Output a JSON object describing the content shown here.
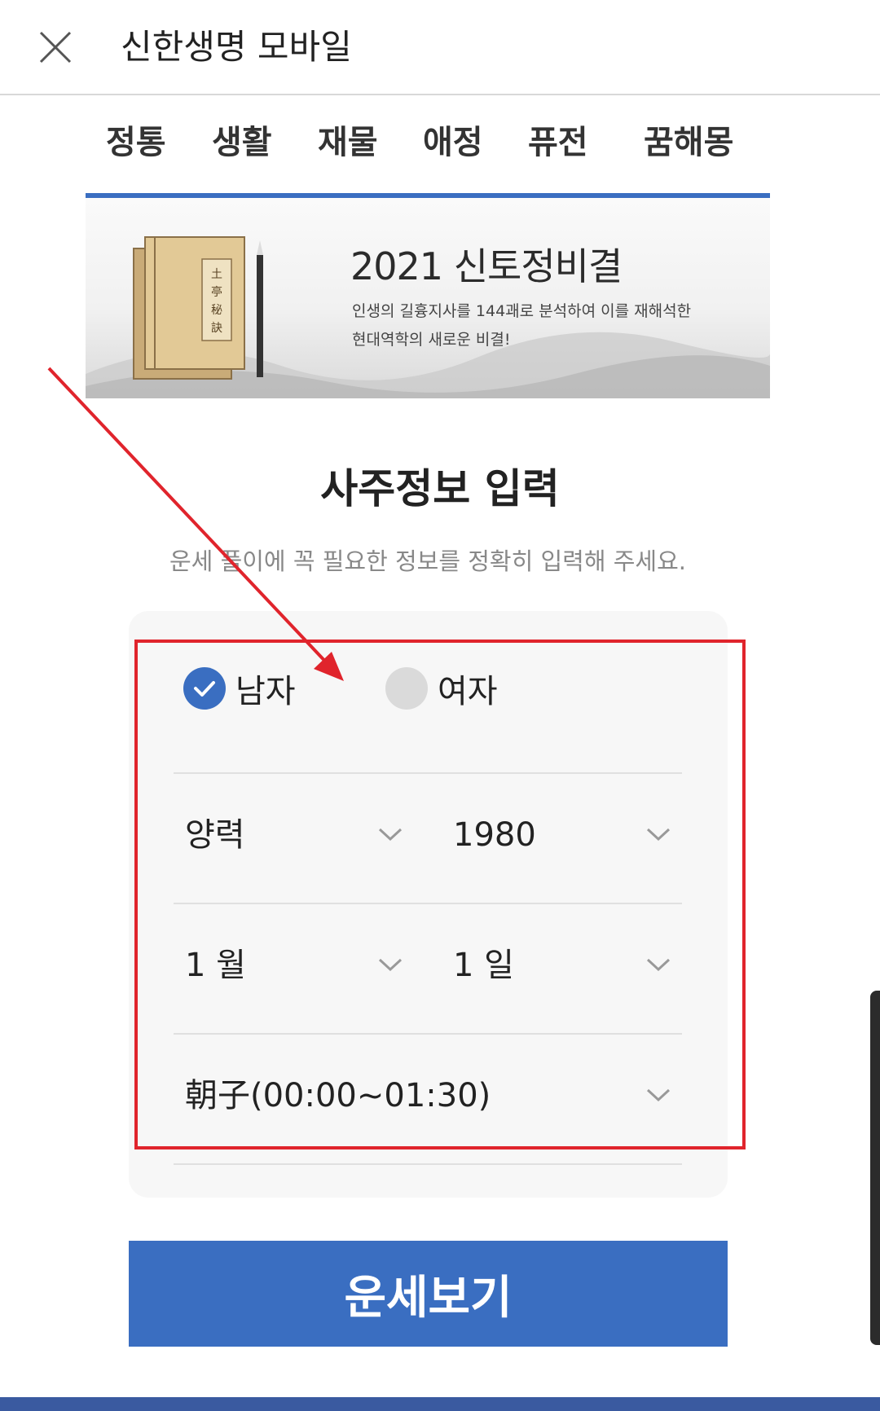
{
  "header": {
    "title": "신한생명 모바일",
    "close_icon": "close-icon"
  },
  "tabs": [
    {
      "label": "정통"
    },
    {
      "label": "생활"
    },
    {
      "label": "재물"
    },
    {
      "label": "애정"
    },
    {
      "label": "퓨전"
    },
    {
      "label": "꿈해몽"
    }
  ],
  "banner": {
    "title": "2021 신토정비결",
    "subtitle_line1": "인생의 길흉지사를 144괘로 분석하여 이를 재해석한",
    "subtitle_line2": "현대역학의 새로운 비결!",
    "book_label": "土亭秘訣"
  },
  "section": {
    "title": "사주정보 입력",
    "subtitle": "운세 풀이에 꼭 필요한 정보를 정확히 입력해 주세요."
  },
  "form": {
    "gender": {
      "male_label": "남자",
      "female_label": "여자",
      "selected": "남자"
    },
    "calendar_type": "양력",
    "year": "1980",
    "month": "1 월",
    "day": "1 일",
    "birth_hour": "朝子(00:00~01:30)"
  },
  "submit_label": "운세보기",
  "colors": {
    "accent": "#3a6ec1",
    "annotation_red": "#e0242c",
    "unselected_radio": "#dadada"
  }
}
